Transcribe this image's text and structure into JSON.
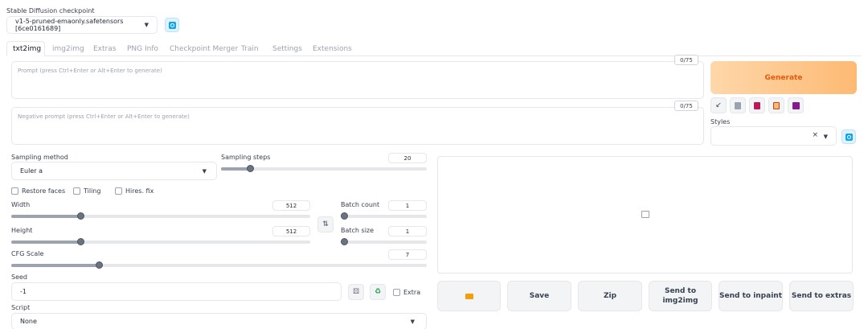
{
  "checkpoint": {
    "label": "Stable Diffusion checkpoint",
    "value": "v1-5-pruned-emaonly.safetensors [6ce0161689]"
  },
  "tabs": [
    {
      "label": "txt2img",
      "active": true
    },
    {
      "label": "img2img"
    },
    {
      "label": "Extras"
    },
    {
      "label": "PNG Info"
    },
    {
      "label": "Checkpoint Merger"
    },
    {
      "label": "Train"
    },
    {
      "label": "Settings"
    },
    {
      "label": "Extensions"
    }
  ],
  "prompt": {
    "placeholder": "Prompt (press Ctrl+Enter or Alt+Enter to generate)",
    "counter": "0/75"
  },
  "negative_prompt": {
    "placeholder": "Negative prompt (press Ctrl+Enter or Alt+Enter to generate)",
    "counter": "0/75"
  },
  "generate_label": "Generate",
  "styles": {
    "label": "Styles",
    "clear_symbol": "×"
  },
  "sampling_method": {
    "label": "Sampling method",
    "value": "Euler a"
  },
  "sampling_steps": {
    "label": "Sampling steps",
    "value": "20",
    "fraction": 0.14
  },
  "checkboxes": {
    "restore_faces": "Restore faces",
    "tiling": "Tiling",
    "hires_fix": "Hires. fix",
    "extra": "Extra"
  },
  "width": {
    "label": "Width",
    "value": "512",
    "fraction": 0.23
  },
  "height": {
    "label": "Height",
    "value": "512",
    "fraction": 0.23
  },
  "batch_count": {
    "label": "Batch count",
    "value": "1",
    "fraction": 0.0
  },
  "batch_size": {
    "label": "Batch size",
    "value": "1",
    "fraction": 0.0
  },
  "cfg_scale": {
    "label": "CFG Scale",
    "value": "7",
    "fraction": 0.21
  },
  "seed": {
    "label": "Seed",
    "value": "-1"
  },
  "script": {
    "label": "Script",
    "value": "None"
  },
  "output_buttons": {
    "save": "Save",
    "zip": "Zip",
    "send_img2img_line1": "Send to",
    "send_img2img_line2": "img2img",
    "send_inpaint": "Send to inpaint",
    "send_extras": "Send to extras"
  },
  "icons": {
    "refresh": "refresh-icon",
    "swap": "swap-icon",
    "image_placeholder": "image-icon",
    "folder": "folder-icon",
    "recycle": "recycle-icon",
    "dice": "dice-icon"
  },
  "colors": {
    "generate_start": "#fed7aa",
    "generate_end": "#fdba74",
    "generate_text": "#ea580c",
    "refresh_bg": "#e0f2fe",
    "refresh_icon": "#0ea5e9"
  }
}
